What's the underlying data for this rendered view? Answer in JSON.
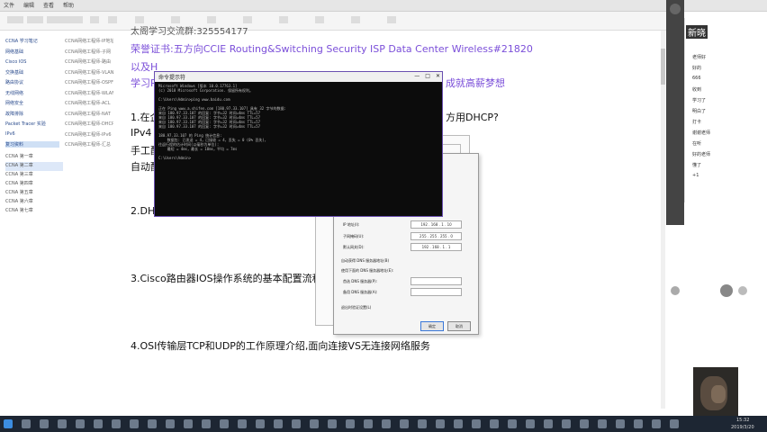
{
  "app": {
    "menu": [
      "文件",
      "编辑",
      "查看",
      "帮助"
    ]
  },
  "sidebar": {
    "items": [
      {
        "label": "CCNA 学习笔记",
        "right": "CCNA网络工程师-IP地址"
      },
      {
        "label": "网络基础",
        "right": "CCNA网络工程师-子网"
      },
      {
        "label": "Cisco IOS",
        "right": "CCNA网络工程师-路由"
      },
      {
        "label": "交换基础",
        "right": "CCNA网络工程师-VLAN"
      },
      {
        "label": "路由协议",
        "right": "CCNA网络工程师-OSPF"
      },
      {
        "label": "无线网络",
        "right": "CCNA网络工程师-WLAN"
      },
      {
        "label": "网络安全",
        "right": "CCNA网络工程师-ACL"
      },
      {
        "label": "故障排除",
        "right": "CCNA网络工程师-NAT"
      },
      {
        "label": "Packet Tracer 实验",
        "right": "CCNA网络工程师-DHCP"
      },
      {
        "label": "IPv6",
        "right": "CCNA网络工程师-IPv6"
      },
      {
        "label": "复习资料",
        "right": "CCNA网络工程师-汇总"
      }
    ],
    "sub": [
      "CCNA 第一章",
      "CCNA 第二章",
      "CCNA 第三章",
      "CCNA 第四章",
      "CCNA 第五章",
      "CCNA 第六章",
      "CCNA 第七章"
    ]
  },
  "doc": {
    "l1": "太阁学习交流群:325554177",
    "l2": "荣誉证书:五方向CCIE Routing&Switching Security ISP Data Center Wireless#21820",
    "l3": "以及H",
    "l4": "学习R",
    "l4b": "成就高薪梦想",
    "l5": "1.在企",
    "l5b": "方用DHCP?",
    "l6": "IPv4",
    "l7": "手工配",
    "l8": "自动配",
    "l9": "2.DHC",
    "l10": "3.Cisco路由器IOS操作系统的基本配置流程",
    "l11": "4.OSI传输层TCP和UDP的工作原理介绍,面向连接VS无连接网络服务"
  },
  "cmd": {
    "title": "命令提示符",
    "lines": [
      "Microsoft Windows [版本 10.0.17763.1]",
      "(c) 2018 Microsoft Corporation. 保留所有权利。",
      "",
      "C:\\Users\\Admin>ping www.baidu.com",
      "",
      "正在 Ping www.a.shifen.com [180.97.33.107] 具有 32 字节的数据:",
      "来自 180.97.33.107 的回复: 字节=32 时间=4ms TTL=57",
      "来自 180.97.33.107 的回复: 字节=32 时间=4ms TTL=57",
      "来自 180.97.33.107 的回复: 字节=32 时间=4ms TTL=57",
      "来自 180.97.33.107 的回复: 字节=32 时间=4ms TTL=57",
      "",
      "180.97.33.107 的 Ping 统计信息:",
      "    数据包: 已发送 = 4，已接收 = 4，丢失 = 0 (0% 丢失)，",
      "往返行程的估计时间(以毫秒为单位):",
      "    最短 = 4ms，最长 = 10ms，平均 = 7ms",
      "",
      "C:\\Users\\Admin>"
    ]
  },
  "dialog": {
    "l1": "使用下面的 IP 地址(S):",
    "l2": "IP 地址(I):",
    "l3": "子网掩码(U):",
    "l4": "默认网关(D):",
    "l5": "自动获得 DNS 服务器地址(B)",
    "l6": "使用下面的 DNS 服务器地址(E):",
    "l7": "首选 DNS 服务器(P):",
    "l8": "备用 DNS 服务器(A):",
    "l9": "退出时验证设置(L)",
    "ip": "192 . 168 . 1 . 10",
    "mask": "255 . 255 . 255 . 0",
    "gw": "192 . 168 . 1 . 1",
    "ok": "确定",
    "cancel": "取消"
  },
  "panel": {
    "title": "新晓",
    "items": [
      "老师好",
      "好的",
      "666",
      "收到",
      "学习了",
      "明白了",
      "打卡",
      "谢谢老师",
      "在听",
      "好的老师",
      "懂了",
      "+1"
    ]
  },
  "taskbar": {
    "time": "15:32",
    "date": "2019/3/20"
  }
}
